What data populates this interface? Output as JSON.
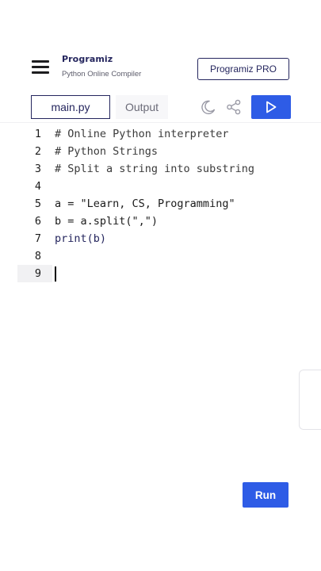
{
  "header": {
    "logo_name": "Programiz",
    "logo_subtitle": "Python Online Compiler",
    "pro_button": "Programiz PRO"
  },
  "toolbar": {
    "tab_main": "main.py",
    "tab_output": "Output",
    "icons": [
      "moon-icon",
      "share-icon",
      "play-icon"
    ]
  },
  "editor": {
    "lines": [
      {
        "num": "1",
        "text": "# Online Python interpreter"
      },
      {
        "num": "2",
        "text": "# Python Strings"
      },
      {
        "num": "3",
        "text": "# Split a string into substring"
      },
      {
        "num": "4",
        "text": ""
      },
      {
        "num": "5",
        "text": "a = \"Learn, CS, Programming\""
      },
      {
        "num": "6",
        "text": "b = a.split(\",\")"
      },
      {
        "num": "7",
        "text": "print(b)"
      },
      {
        "num": "8",
        "text": ""
      },
      {
        "num": "9",
        "text": ""
      }
    ]
  },
  "run_button": "Run",
  "colors": {
    "accent": "#2e5ce6",
    "brand": "#25265e"
  }
}
